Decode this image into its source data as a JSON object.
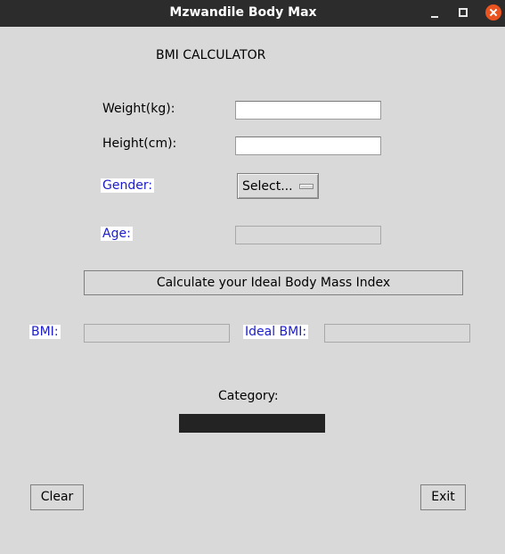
{
  "window": {
    "title": "Mzwandile Body Max"
  },
  "form": {
    "heading": "BMI CALCULATOR",
    "weight_label": "Weight(kg):",
    "weight_value": "",
    "height_label": "Height(cm):",
    "height_value": "",
    "gender_label": "Gender:",
    "gender_selected": "Select...",
    "age_label": "Age:",
    "age_value": "",
    "calculate_label": "Calculate your Ideal Body Mass Index"
  },
  "results": {
    "bmi_label": "BMI:",
    "bmi_value": "",
    "ideal_bmi_label": "Ideal BMI:",
    "ideal_bmi_value": "",
    "category_label": "Category:",
    "category_value": ""
  },
  "actions": {
    "clear_label": "Clear",
    "exit_label": "Exit"
  },
  "colors": {
    "accent_label": "#1c1ccc",
    "close_button": "#e95420",
    "category_bar": "#232323"
  }
}
